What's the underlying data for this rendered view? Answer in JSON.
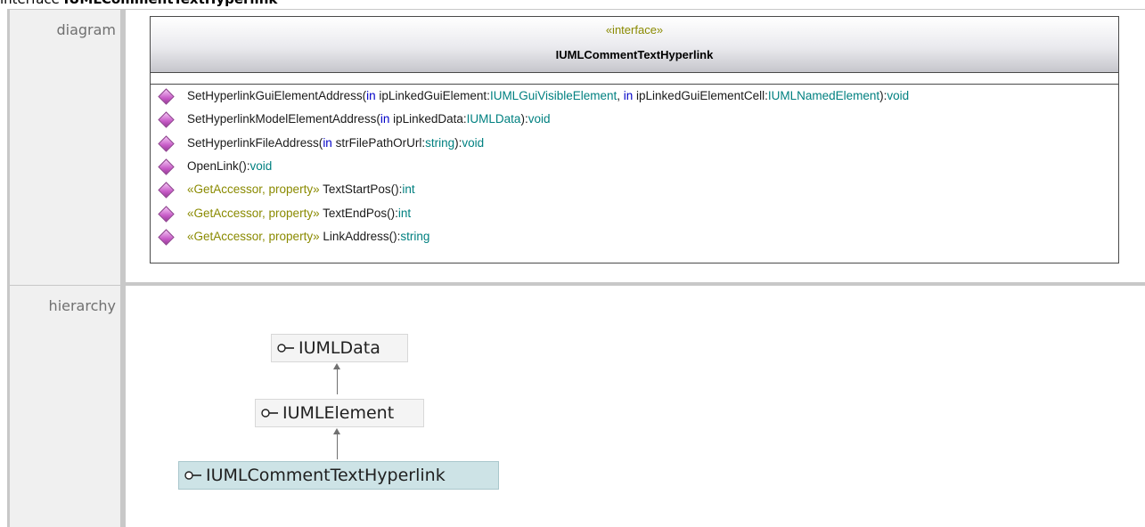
{
  "page_title": {
    "prefix": "interface ",
    "name": "IUMLCommentTextHyperlink"
  },
  "diagram": {
    "label": "diagram",
    "stereotype": "«interface»",
    "class_name": "IUMLCommentTextHyperlink",
    "operations": [
      {
        "name": "SetHyperlinkGuiElementAddress(",
        "parts": [
          {
            "t": "in",
            "c": "kw"
          },
          {
            "t": " ipLinkedGuiElement:",
            "c": ""
          },
          {
            "t": "IUMLGuiVisibleElement",
            "c": "ty"
          },
          {
            "t": ", ",
            "c": ""
          },
          {
            "t": "in",
            "c": "kw"
          },
          {
            "t": " ipLinkedGuiElementCell:",
            "c": ""
          },
          {
            "t": "IUMLNamedElement",
            "c": "ty"
          },
          {
            "t": "):",
            "c": ""
          },
          {
            "t": "void",
            "c": "ty"
          }
        ]
      },
      {
        "name": "SetHyperlinkModelElementAddress(",
        "parts": [
          {
            "t": "in",
            "c": "kw"
          },
          {
            "t": " ipLinkedData:",
            "c": ""
          },
          {
            "t": "IUMLData",
            "c": "ty"
          },
          {
            "t": "):",
            "c": ""
          },
          {
            "t": "void",
            "c": "ty"
          }
        ]
      },
      {
        "name": "SetHyperlinkFileAddress(",
        "parts": [
          {
            "t": "in",
            "c": "kw"
          },
          {
            "t": " strFilePathOrUrl:",
            "c": ""
          },
          {
            "t": "string",
            "c": "ty"
          },
          {
            "t": "):",
            "c": ""
          },
          {
            "t": "void",
            "c": "ty"
          }
        ]
      },
      {
        "name": "OpenLink():",
        "parts": [
          {
            "t": "void",
            "c": "ty"
          }
        ]
      },
      {
        "name": "",
        "parts": [
          {
            "t": "«GetAccessor, property»",
            "c": "st"
          },
          {
            "t": " TextStartPos():",
            "c": ""
          },
          {
            "t": "int",
            "c": "ty"
          }
        ]
      },
      {
        "name": "",
        "parts": [
          {
            "t": "«GetAccessor, property»",
            "c": "st"
          },
          {
            "t": " TextEndPos():",
            "c": ""
          },
          {
            "t": "int",
            "c": "ty"
          }
        ]
      },
      {
        "name": "",
        "parts": [
          {
            "t": "«GetAccessor, property»",
            "c": "st"
          },
          {
            "t": " LinkAddress():",
            "c": ""
          },
          {
            "t": "string",
            "c": "ty"
          }
        ]
      }
    ]
  },
  "hierarchy": {
    "label": "hierarchy",
    "nodes": [
      "IUMLData",
      "IUMLElement",
      "IUMLCommentTextHyperlink"
    ]
  },
  "colors": {
    "keyword": "#0000c8",
    "type": "#008080",
    "stereotype": "#8a8a00",
    "operation_icon": "#c85cc8",
    "current_node": "#cde3e6"
  },
  "icons": {
    "operation": "operation-diamond-icon",
    "interface": "interface-lollipop-icon"
  }
}
